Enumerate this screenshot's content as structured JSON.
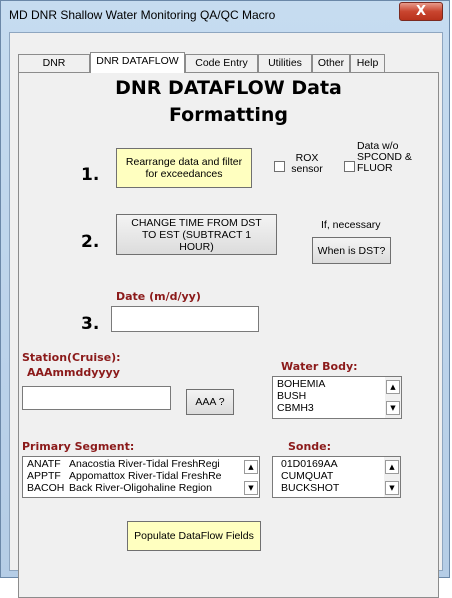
{
  "window": {
    "title": "MD DNR Shallow Water Monitoring QA/QC Macro",
    "close_glyph": "X"
  },
  "tabs": [
    {
      "label": "DNR CONTMON",
      "active": false
    },
    {
      "label": "DNR DATAFLOW",
      "active": true
    },
    {
      "label": "Code Entry",
      "active": false
    },
    {
      "label": "Utilities",
      "active": false
    },
    {
      "label": "Other",
      "active": false
    },
    {
      "label": "Help",
      "active": false
    }
  ],
  "heading": {
    "line1": "DNR DATAFLOW Data",
    "line2": "Formatting"
  },
  "step1": {
    "number": "1.",
    "button_label": "Rearrange data and filter for exceedances",
    "rox_checkbox_label": "ROX sensor",
    "rox_checked": false,
    "nospcond_checkbox_label": "Data w/o SPCOND & FLUOR",
    "nospcond_checked": false
  },
  "step2": {
    "number": "2.",
    "button_label": "CHANGE TIME FROM DST TO EST (SUBTRACT 1 HOUR)",
    "note": "If, necessary",
    "dst_button_label": "When is DST?"
  },
  "step3": {
    "number": "3.",
    "date_label": "Date (m/d/yy)",
    "date_value": ""
  },
  "station": {
    "label": "Station(Cruise):",
    "format_hint": "AAAmmddyyyy",
    "value": "",
    "aaa_button_label": "AAA ?"
  },
  "water_body": {
    "label": "Water Body:",
    "items": [
      "BOHEMIA",
      "BUSH",
      "CBMH3"
    ]
  },
  "primary_segment": {
    "label": "Primary Segment:",
    "items": [
      {
        "code": "ANATF",
        "name": "Anacostia River-Tidal FreshRegi"
      },
      {
        "code": "APPTF",
        "name": "Appomattox River-Tidal FreshRe"
      },
      {
        "code": "BACOH",
        "name": "Back River-Oligohaline Region"
      }
    ]
  },
  "sonde": {
    "label": "Sonde:",
    "items": [
      "01D0169AA",
      "CUMQUAT",
      "BUCKSHOT"
    ]
  },
  "populate_button_label": "Populate DataFlow Fields",
  "colors": {
    "accent_label": "#8b1a1a",
    "highlight_button": "#ffffc0",
    "close_button": "#c9452f"
  },
  "icons": {
    "scroll_up": "▲",
    "scroll_down": "▼"
  }
}
